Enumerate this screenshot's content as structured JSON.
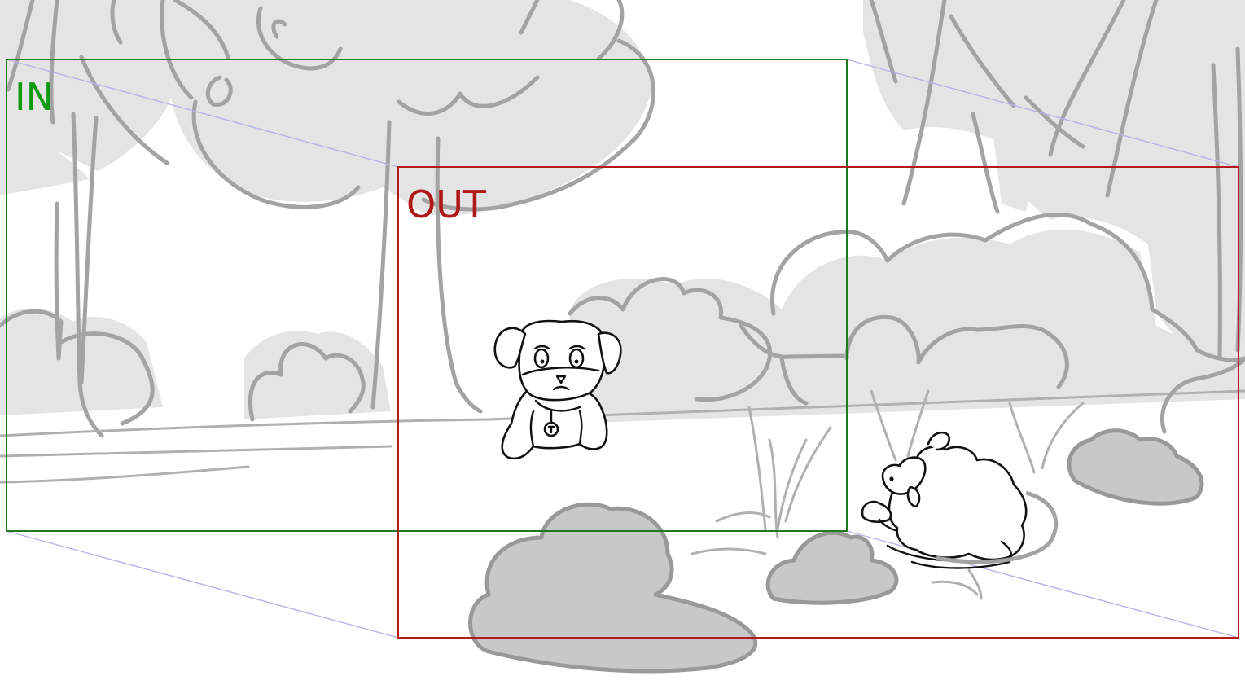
{
  "frames": {
    "in": {
      "label": "IN",
      "color": "#109a10"
    },
    "out": {
      "label": "OUT",
      "color": "#b01818"
    }
  },
  "colors": {
    "frame_in": "#1f7a1f",
    "frame_out": "#b31b1b",
    "projection": "#b4b4e6",
    "tone": "#e4e4e4",
    "bush_fill": "#c8c8c8",
    "sketch_line": "#a3a3a3",
    "ink": "#111111"
  }
}
